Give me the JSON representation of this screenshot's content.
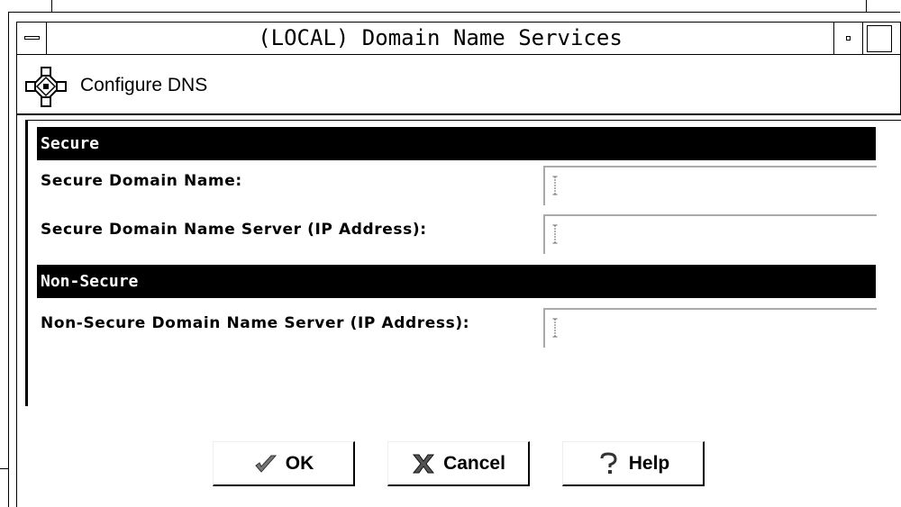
{
  "window": {
    "title": "(LOCAL) Domain Name Services"
  },
  "header": {
    "title": "Configure DNS",
    "icon": "network-config-icon"
  },
  "sections": {
    "secure": {
      "heading": "Secure",
      "domain_name_label": "Secure Domain Name:",
      "domain_name_value": "",
      "server_label": "Secure Domain Name Server (IP Address):",
      "server_value": ""
    },
    "non_secure": {
      "heading": "Non-Secure",
      "server_label": "Non-Secure Domain Name Server (IP Address):",
      "server_value": ""
    }
  },
  "buttons": {
    "ok": "OK",
    "cancel": "Cancel",
    "help": "Help"
  },
  "colors": {
    "section_bar": "#000000",
    "section_text": "#ffffff",
    "field_bevel": "#aaaaaa"
  }
}
